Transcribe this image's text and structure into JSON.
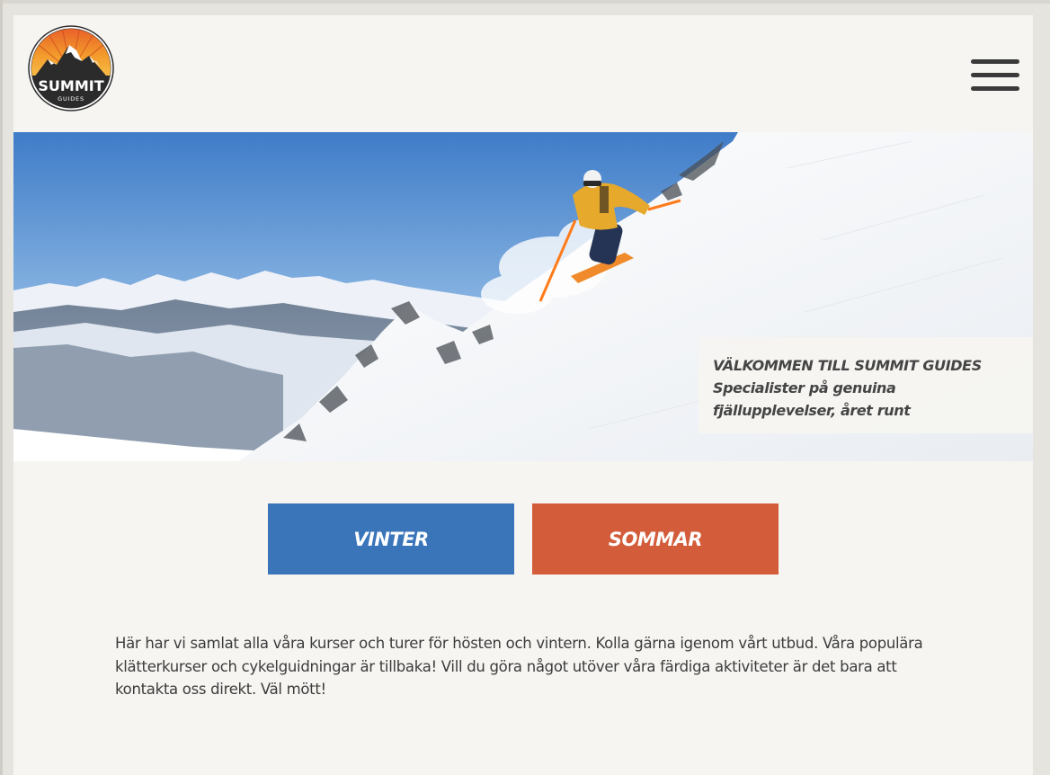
{
  "brand": {
    "logo_line1": "SUMMIT",
    "logo_line2": "GUIDES"
  },
  "header": {
    "menu_icon": "hamburger-menu-icon"
  },
  "hero": {
    "title": "VÄLKOMMEN TILL SUMMIT GUIDES",
    "subtitle": "Specialister på genuina fjällupplevelser, året runt"
  },
  "seasons": {
    "winter_label": "VINTER",
    "summer_label": "SOMMAR"
  },
  "intro": {
    "text": "Här har vi samlat alla våra kurser och turer för hösten och vintern. Kolla gärna igenom vårt utbud. Våra populära klätterkurser och cykelguidningar är tillbaka! Vill du göra något utöver våra färdiga aktiviteter är det bara att kontakta oss direkt. Väl mött!"
  },
  "colors": {
    "winter": "#3a74b9",
    "summer": "#d35d3a",
    "background": "#f6f5f2",
    "text": "#3c3c3c"
  }
}
